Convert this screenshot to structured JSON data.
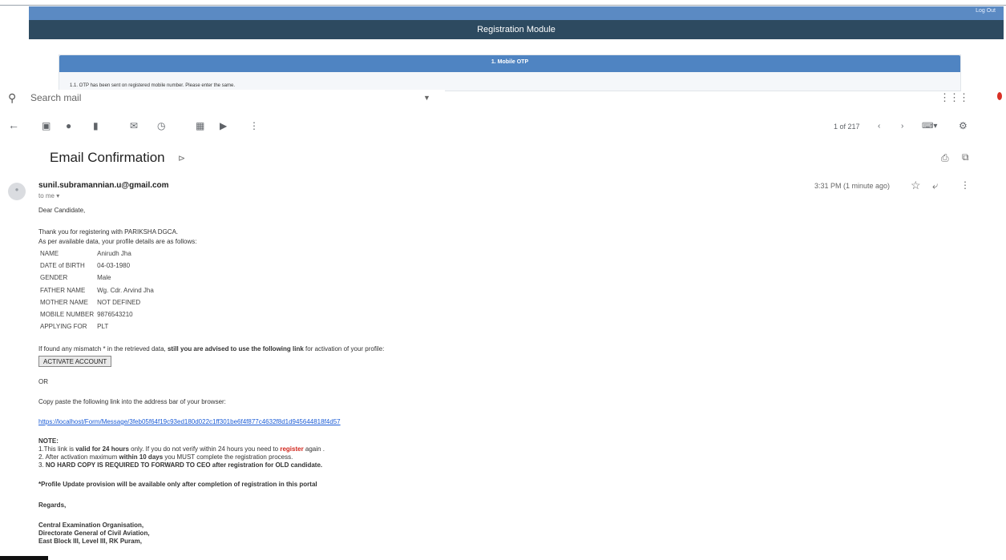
{
  "registration": {
    "logout": "Log Out",
    "title": "Registration Module",
    "step_title": "1. Mobile OTP",
    "otp_message": "1.1. OTP has been sent on registered mobile number. Please enter the same."
  },
  "search": {
    "placeholder": "Search mail"
  },
  "toolbar": {
    "pager": "1 of 217"
  },
  "email": {
    "subject": "Email Confirmation",
    "sender": "sunil.subramannian.u@gmail.com",
    "to": "to me",
    "time": "3:31 PM (1 minute ago)",
    "greeting": "Dear Candidate,",
    "thanks": "Thank you for registering with PARIKSHA DGCA.",
    "profile_intro": "As per available data, your profile details are as follows:",
    "profile": [
      {
        "label": "NAME",
        "value": "Anirudh Jha"
      },
      {
        "label": "DATE of BIRTH",
        "value": "04-03-1980"
      },
      {
        "label": "GENDER",
        "value": "Male"
      },
      {
        "label": "FATHER NAME",
        "value": "Wg. Cdr. Arvind Jha"
      },
      {
        "label": "MOTHER NAME",
        "value": "NOT DEFINED"
      },
      {
        "label": "MOBILE NUMBER",
        "value": "9876543210"
      },
      {
        "label": "APPLYING FOR",
        "value": "PLT"
      }
    ],
    "mismatch_pre": "If found any mismatch * in the retrieved data, ",
    "mismatch_bold": "still you are advised to use the following link",
    "mismatch_post": " for activation of your profile:",
    "activate_button": "ACTIVATE ACCOUNT",
    "or": "OR",
    "copy_paste": "Copy paste the following link into the address bar of your browser:",
    "link": "https://localhost/Form/Message/3feb05f64f19c93ed180d022c1ff301be6f4f877c4632f8d1d945644818f4d57",
    "note_title": "NOTE:",
    "note1_a": "1.This link is ",
    "note1_b": "valid for 24 hours",
    "note1_c": " only. If you do not verify within 24 hours you need to ",
    "note1_d": "register",
    "note1_e": " again .",
    "note2_a": "2. After activation maximum ",
    "note2_b": "within 10 days",
    "note2_c": " you MUST complete the registration process.",
    "note3_a": "3. ",
    "note3_b": "NO HARD COPY IS REQUIRED TO FORWARD TO CEO after registration for OLD candidate.",
    "profile_update": "*Profile Update provision will be available only after completion of registration in this portal",
    "regards": "Regards,",
    "sig1": "Central Examination Organisation,",
    "sig2": "Directorate General of Civil Aviation,",
    "sig3": "East Block III, Level III, RK Puram,"
  }
}
